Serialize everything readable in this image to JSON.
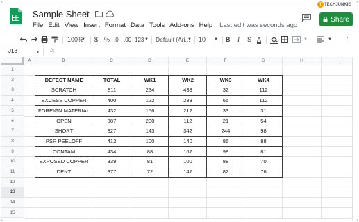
{
  "app": {
    "title": "Sample Sheet",
    "last_edit": "Last edit was seconds ago",
    "share_label": "Share",
    "watermark": "TECHJUNKIE",
    "brand_color": "#1e8e3e"
  },
  "menu": [
    "File",
    "Edit",
    "View",
    "Insert",
    "Format",
    "Data",
    "Tools",
    "Add-ons",
    "Help"
  ],
  "toolbar": {
    "zoom": "100%",
    "currency": "$",
    "percent": "%",
    "dec_decrease": ".0",
    "dec_increase": ".00",
    "more_formats": "123",
    "font": "Default (Ari...",
    "font_size": "10",
    "bold": "B",
    "italic": "I",
    "strike": "S",
    "text_color": "A"
  },
  "formula_bar": {
    "cell_ref": "J13",
    "fx": "fx",
    "value": ""
  },
  "columns": [
    "A",
    "B",
    "C",
    "D",
    "E",
    "F",
    "G",
    "H",
    "I"
  ],
  "rows": [
    "1",
    "2",
    "3",
    "4",
    "5",
    "6",
    "7",
    "8",
    "9",
    "10",
    "11",
    "12",
    "13",
    "14",
    "15"
  ],
  "selected_row": "13",
  "table": {
    "headers": [
      "DEFECT NAME",
      "TOTAL",
      "WK1",
      "WK2",
      "WK3",
      "WK4"
    ],
    "data": [
      [
        "SCRATCH",
        "811",
        "234",
        "433",
        "32",
        "112"
      ],
      [
        "EXCESS COPPER",
        "400",
        "122",
        "233",
        "65",
        "112"
      ],
      [
        "FOREIGN MATERIAL",
        "432",
        "156",
        "212",
        "33",
        "31"
      ],
      [
        "OPEN",
        "387",
        "200",
        "112",
        "21",
        "54"
      ],
      [
        "SHORT",
        "827",
        "143",
        "342",
        "244",
        "98"
      ],
      [
        "PSR PEELOFF",
        "413",
        "100",
        "140",
        "85",
        "88"
      ],
      [
        "CONTAM",
        "434",
        "88",
        "167",
        "98",
        "81"
      ],
      [
        "EXPOSED COPPER",
        "339",
        "81",
        "100",
        "88",
        "70"
      ],
      [
        "DENT",
        "377",
        "72",
        "147",
        "82",
        "76"
      ]
    ]
  }
}
